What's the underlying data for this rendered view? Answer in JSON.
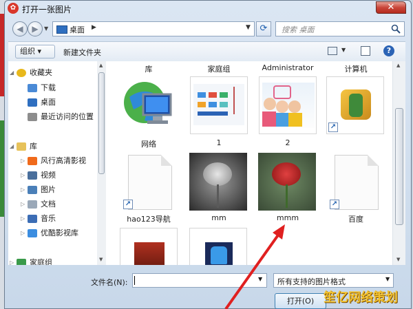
{
  "window": {
    "title": "打开一张图片",
    "app_icon": "app-icon"
  },
  "navbar": {
    "breadcrumb": [
      "桌面"
    ],
    "search_placeholder": "搜索 桌面"
  },
  "toolbar": {
    "organize": "组织 ▾",
    "new_folder": "新建文件夹"
  },
  "nav_pane": {
    "items": [
      {
        "label": "收藏夹",
        "icon": "star-icon",
        "color": "#e8b81c"
      },
      {
        "label": "下载",
        "icon": "download-folder-icon",
        "color": "#4a8ad6"
      },
      {
        "label": "桌面",
        "icon": "desktop-icon",
        "color": "#2f6fc0"
      },
      {
        "label": "最近访问的位置",
        "icon": "recent-places-icon",
        "color": "#8d8d8d"
      },
      {
        "label": "库",
        "icon": "library-icon",
        "color": "#e7c25a"
      },
      {
        "label": "风行高清影视",
        "icon": "fengxing-icon",
        "color": "#f06a1b"
      },
      {
        "label": "视频",
        "icon": "video-library-icon",
        "color": "#4a6f9c"
      },
      {
        "label": "图片",
        "icon": "pictures-library-icon",
        "color": "#4a7fb8"
      },
      {
        "label": "文档",
        "icon": "documents-library-icon",
        "color": "#9aa8b8"
      },
      {
        "label": "音乐",
        "icon": "music-library-icon",
        "color": "#3c6db5"
      },
      {
        "label": "优酷影视库",
        "icon": "youku-icon",
        "color": "#3b8de0"
      },
      {
        "label": "家庭组",
        "icon": "homegroup-icon",
        "color": "#3a9a4a"
      }
    ]
  },
  "content": {
    "column_headers": [
      "库",
      "家庭组",
      "Administrator",
      "计算机"
    ],
    "items": [
      {
        "label": "网络",
        "kind": "network-icon"
      },
      {
        "label": "1",
        "kind": "thumbnail-webpage"
      },
      {
        "label": "2",
        "kind": "thumbnail-photo-children"
      },
      {
        "label": "",
        "kind": "thumbnail-game-shortcut"
      },
      {
        "label": "hao123导航",
        "kind": "generic-file-shortcut"
      },
      {
        "label": "mm",
        "kind": "thumbnail-rose-grayscale"
      },
      {
        "label": "mmm",
        "kind": "thumbnail-rose-color"
      },
      {
        "label": "百度",
        "kind": "generic-file-shortcut"
      },
      {
        "label": "",
        "kind": "thumbnail-game"
      },
      {
        "label": "",
        "kind": "thumbnail-pixel-character"
      }
    ]
  },
  "bottom": {
    "filename_label": "文件名(N):",
    "filename_value": "",
    "filetype": "所有支持的图片格式",
    "open_button": "打开(O)"
  },
  "overlay": {
    "annotation": "red-arrow-icon",
    "watermark": "笙亿网络策划"
  },
  "colors": {
    "accent": "#2b63b5",
    "arrow": "#e02020"
  }
}
